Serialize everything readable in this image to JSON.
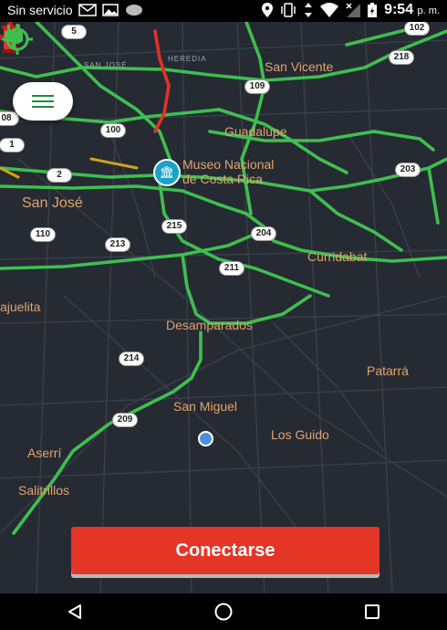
{
  "status_bar": {
    "carrier": "Sin servicio",
    "time": "9:54",
    "ampm": "p. m.",
    "icons": [
      "gmail-icon",
      "image-icon",
      "chat-bubble-icon",
      "location-icon",
      "vibrate-icon",
      "data-arrows-icon",
      "wifi-icon",
      "no-signal-icon",
      "battery-charging-icon"
    ]
  },
  "map": {
    "places": [
      {
        "name": "San Vicente"
      },
      {
        "name": "Guadalupe"
      },
      {
        "name": "Museo Nacional"
      },
      {
        "name": "de Costa Rica"
      },
      {
        "name": "San José"
      },
      {
        "name": "Curridabat"
      },
      {
        "name": "ajuelita"
      },
      {
        "name": "Desamparados"
      },
      {
        "name": "Patarrá"
      },
      {
        "name": "San Miguel"
      },
      {
        "name": "Los Guido"
      },
      {
        "name": "Aserrí"
      },
      {
        "name": "Salitrillos"
      }
    ],
    "road_labels": [
      "SAN JOSÉ",
      "HEREDIA"
    ],
    "route_shields": [
      "5",
      "102",
      "218",
      "109",
      "08",
      "100",
      "1",
      "2",
      "203",
      "215",
      "204",
      "110",
      "213",
      "211",
      "214",
      "209"
    ],
    "colors": {
      "traffic_green": "#3fbf4f",
      "traffic_red": "#e0322a",
      "place_text": "#e3a36a",
      "map_bg": "#262b33"
    }
  },
  "menu_button": {
    "icon": "hamburger-menu-icon"
  },
  "connect_button": {
    "label": "Conectarse",
    "color": "#e53527"
  },
  "locate_button": {
    "icon": "gps-locate-icon"
  },
  "plug_button": {
    "icon": "plug-icon"
  },
  "nav_bar": {
    "buttons": [
      "back-triangle-icon",
      "home-circle-icon",
      "recents-square-icon"
    ]
  }
}
